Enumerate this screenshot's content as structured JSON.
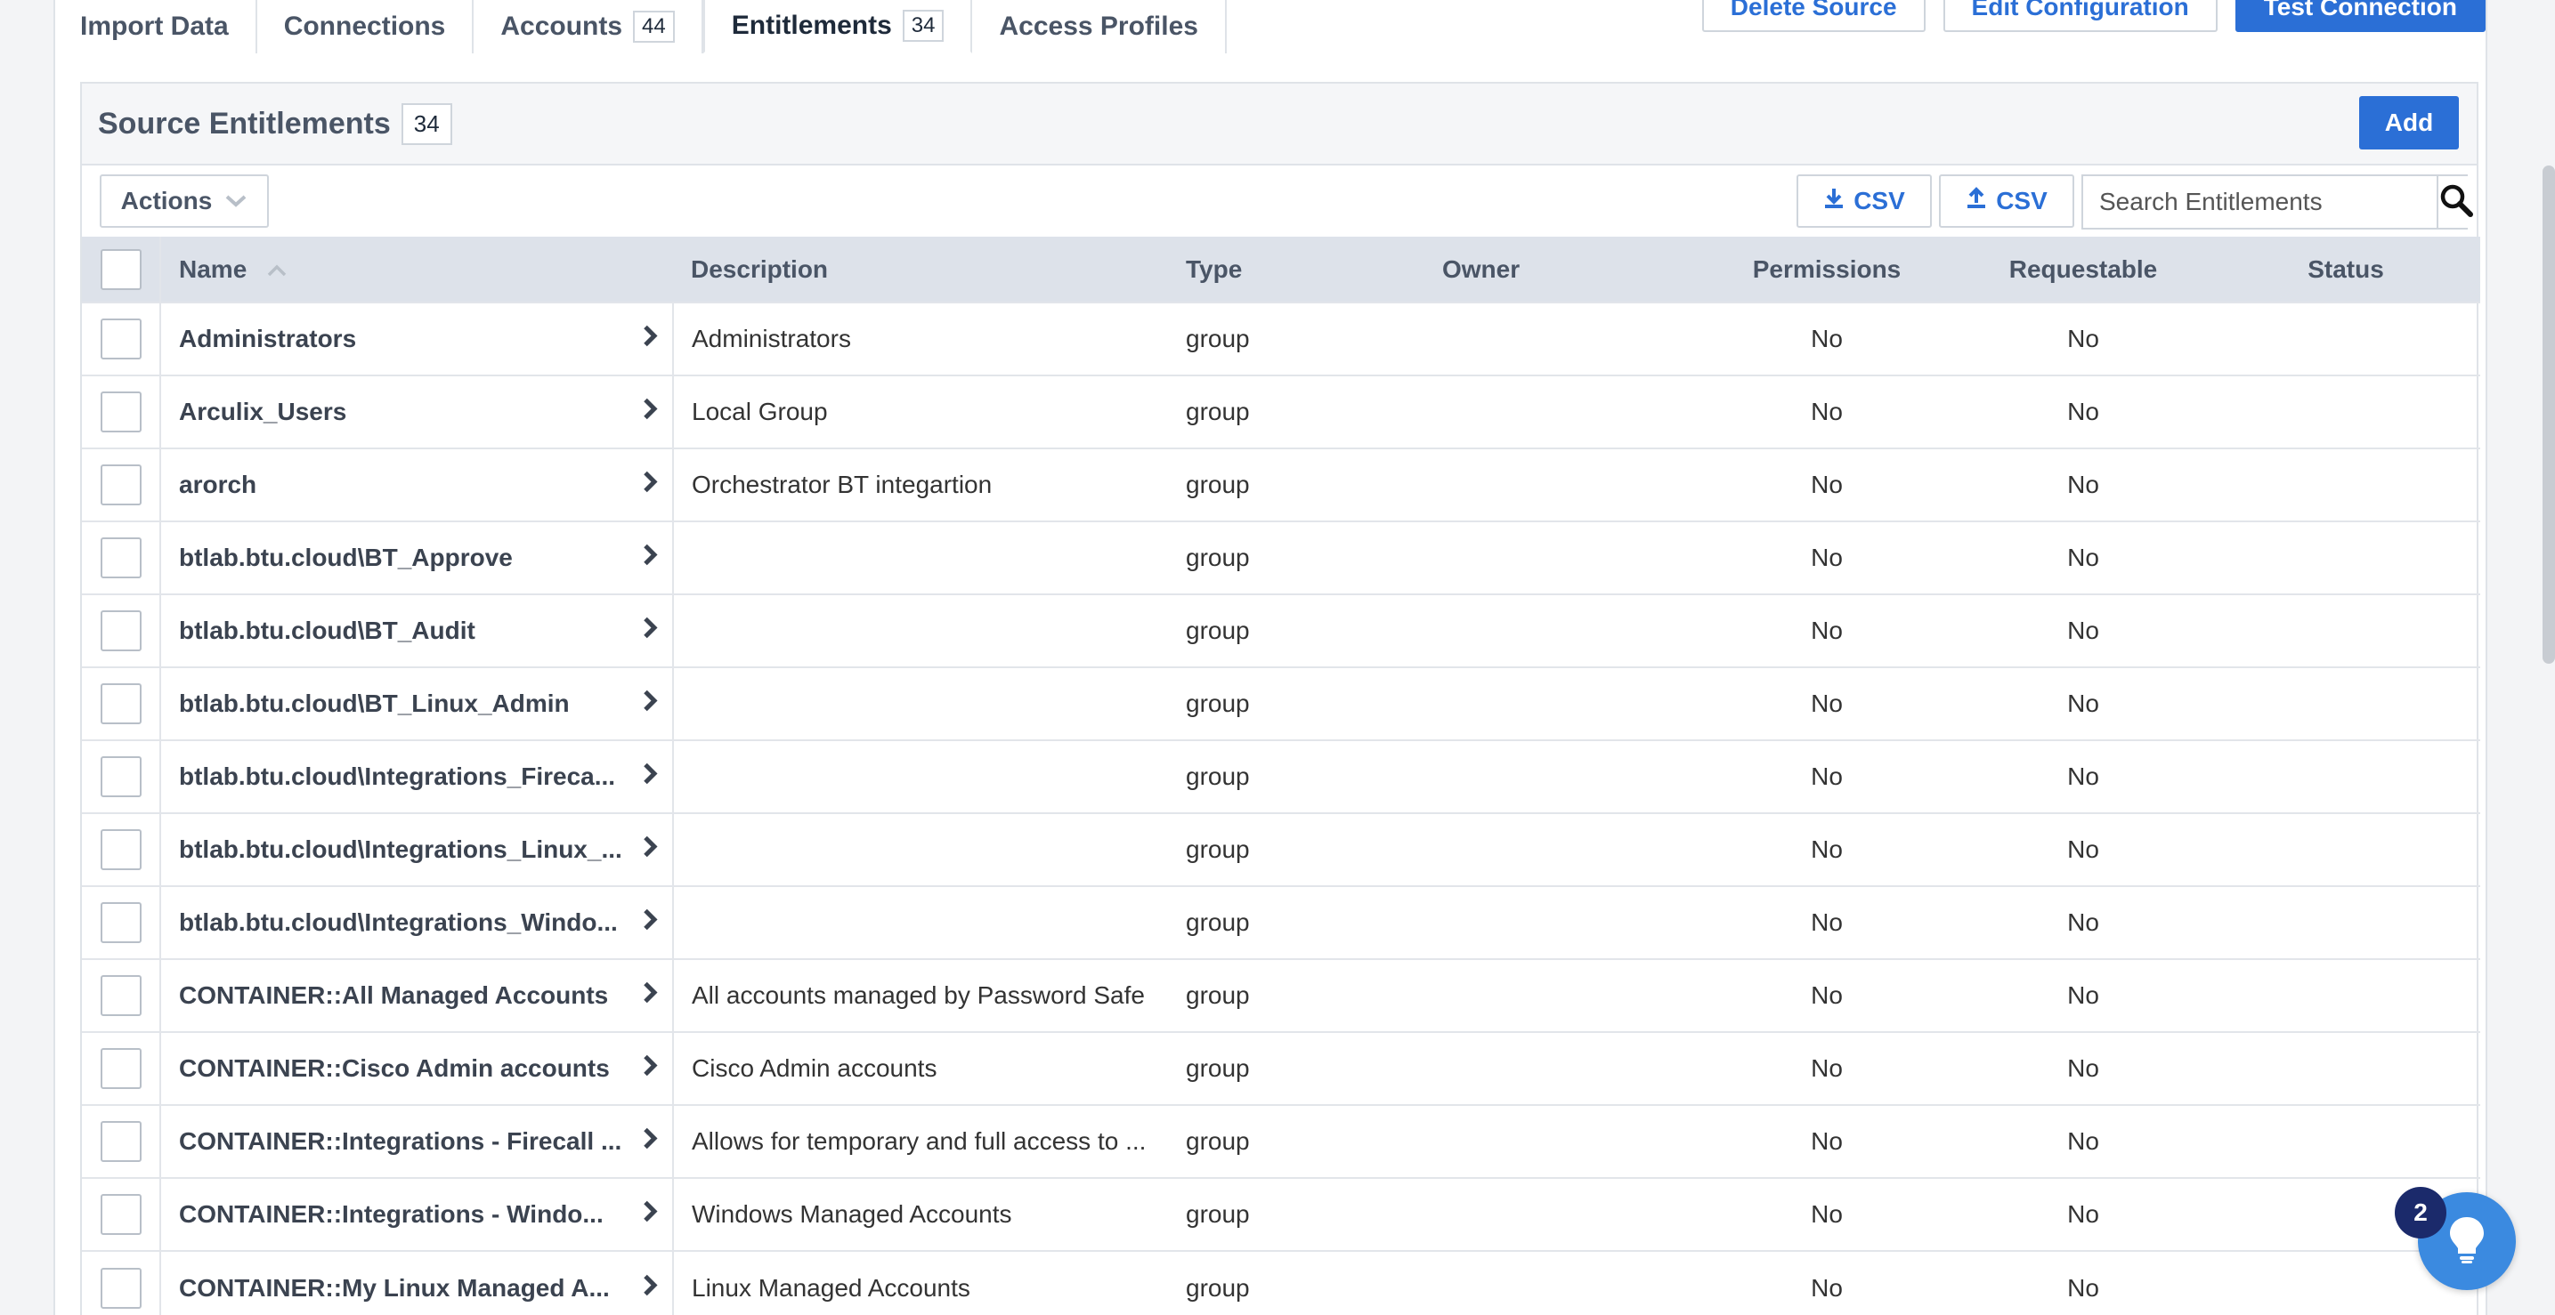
{
  "tabs": [
    {
      "label": "Import Data",
      "count": null
    },
    {
      "label": "Connections",
      "count": null
    },
    {
      "label": "Accounts",
      "count": "44"
    },
    {
      "label": "Entitlements",
      "count": "34"
    },
    {
      "label": "Access Profiles",
      "count": null
    }
  ],
  "top_actions": {
    "delete": "Delete Source",
    "edit": "Edit Configuration",
    "test": "Test Connection"
  },
  "panel": {
    "title": "Source Entitlements",
    "count": "34",
    "add_label": "Add",
    "actions_label": "Actions",
    "csv_download_label": "CSV",
    "csv_upload_label": "CSV",
    "search_placeholder": "Search Entitlements"
  },
  "columns": {
    "name": "Name",
    "description": "Description",
    "type": "Type",
    "owner": "Owner",
    "permissions": "Permissions",
    "requestable": "Requestable",
    "status": "Status"
  },
  "rows": [
    {
      "name": "Administrators",
      "description": "Administrators",
      "type": "group",
      "owner": "",
      "permissions": "No",
      "requestable": "No",
      "status": ""
    },
    {
      "name": "Arculix_Users",
      "description": "Local Group",
      "type": "group",
      "owner": "",
      "permissions": "No",
      "requestable": "No",
      "status": ""
    },
    {
      "name": "arorch",
      "description": "Orchestrator BT integartion",
      "type": "group",
      "owner": "",
      "permissions": "No",
      "requestable": "No",
      "status": ""
    },
    {
      "name": "btlab.btu.cloud\\BT_Approve",
      "description": "",
      "type": "group",
      "owner": "",
      "permissions": "No",
      "requestable": "No",
      "status": ""
    },
    {
      "name": "btlab.btu.cloud\\BT_Audit",
      "description": "",
      "type": "group",
      "owner": "",
      "permissions": "No",
      "requestable": "No",
      "status": ""
    },
    {
      "name": "btlab.btu.cloud\\BT_Linux_Admin",
      "description": "",
      "type": "group",
      "owner": "",
      "permissions": "No",
      "requestable": "No",
      "status": ""
    },
    {
      "name": "btlab.btu.cloud\\Integrations_Fireca...",
      "description": "",
      "type": "group",
      "owner": "",
      "permissions": "No",
      "requestable": "No",
      "status": ""
    },
    {
      "name": "btlab.btu.cloud\\Integrations_Linux_...",
      "description": "",
      "type": "group",
      "owner": "",
      "permissions": "No",
      "requestable": "No",
      "status": ""
    },
    {
      "name": "btlab.btu.cloud\\Integrations_Windo...",
      "description": "",
      "type": "group",
      "owner": "",
      "permissions": "No",
      "requestable": "No",
      "status": ""
    },
    {
      "name": "CONTAINER::All Managed Accounts",
      "description": "All accounts managed by Password Safe",
      "type": "group",
      "owner": "",
      "permissions": "No",
      "requestable": "No",
      "status": ""
    },
    {
      "name": "CONTAINER::Cisco Admin accounts",
      "description": "Cisco Admin accounts",
      "type": "group",
      "owner": "",
      "permissions": "No",
      "requestable": "No",
      "status": ""
    },
    {
      "name": "CONTAINER::Integrations - Firecall ...",
      "description": "Allows for temporary and full access to ...",
      "type": "group",
      "owner": "",
      "permissions": "No",
      "requestable": "No",
      "status": ""
    },
    {
      "name": "CONTAINER::Integrations - Windo...",
      "description": "Windows Managed Accounts",
      "type": "group",
      "owner": "",
      "permissions": "No",
      "requestable": "No",
      "status": ""
    },
    {
      "name": "CONTAINER::My Linux Managed A...",
      "description": "Linux Managed Accounts",
      "type": "group",
      "owner": "",
      "permissions": "No",
      "requestable": "No",
      "status": ""
    }
  ],
  "help": {
    "count": "2"
  },
  "colors": {
    "accent": "#2b6fd6",
    "header_bg": "#dde2ea",
    "badge": "#1b2a6b"
  }
}
